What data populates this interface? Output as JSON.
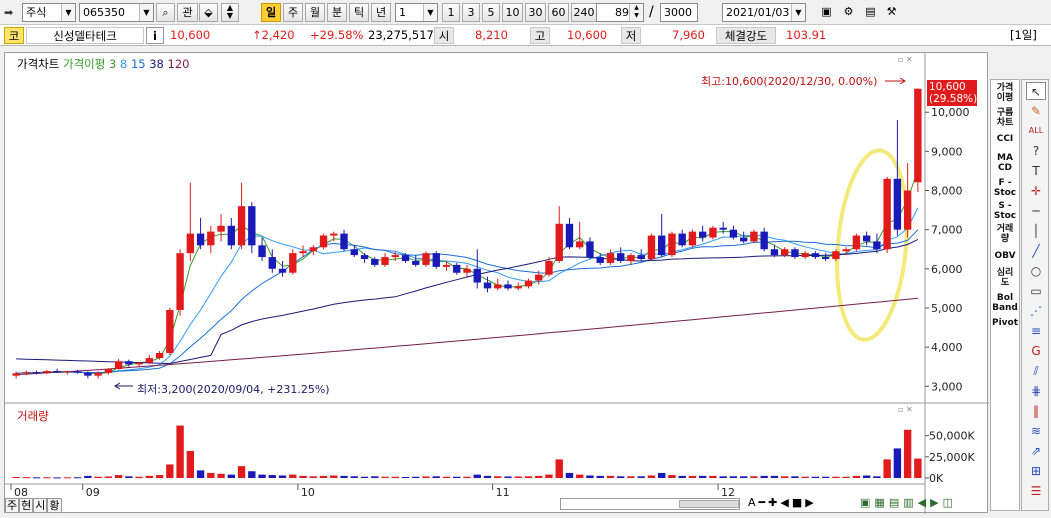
{
  "toolbar": {
    "market": "주식",
    "code": "065350",
    "gwan": "관",
    "periods": [
      "일",
      "주",
      "월",
      "분",
      "틱",
      "년"
    ],
    "active_period": "일",
    "interval": "1",
    "quick": [
      "1",
      "3",
      "5",
      "10",
      "30",
      "60",
      "240"
    ],
    "count": "89",
    "slash": "/",
    "total": "3000",
    "date": "2021/01/03",
    "period_label": "[1일]"
  },
  "quote": {
    "market_badge": "코",
    "name": "신성델타테크",
    "info": "i",
    "price": "10,600",
    "change": "↑2,420",
    "change_pct": "+29.58%",
    "volume": "23,275,517",
    "open_label": "시",
    "open": "8,210",
    "high_label": "고",
    "high": "10,600",
    "low_label": "저",
    "low": "7,960",
    "strength_label": "체결강도",
    "strength": "103.91"
  },
  "legend": {
    "price_chart": "가격차트",
    "ma_label": "가격이평",
    "ma_periods": [
      "3",
      "8",
      "15",
      "38",
      "120"
    ],
    "ma_colors": [
      "#3a9a2a",
      "#3399ff",
      "#1a6fd4",
      "#1a1a7a",
      "#7a1a4a"
    ],
    "volume_label": "거래량"
  },
  "annotations": {
    "high_note": "최고:10,600(2020/12/30, 0.00%)",
    "low_note": "최저:3,200(2020/09/04, +231.25%)",
    "current_price": "10,600",
    "current_pct": "(29.58%)"
  },
  "colors": {
    "up": "#e11b1b",
    "down": "#1a1ab8",
    "highlight": "#f2ea7a"
  },
  "chart_data": {
    "type": "candlestick",
    "y_ticks": [
      "10,000",
      "9,000",
      "8,000",
      "7,000",
      "6,000",
      "5,000",
      "4,000",
      "3,000"
    ],
    "y_tick_values": [
      10000,
      9000,
      8000,
      7000,
      6000,
      5000,
      4000,
      3000
    ],
    "ylim": [
      2700,
      10900
    ],
    "x_ticks": [
      {
        "label": "08",
        "index": 0
      },
      {
        "label": "09",
        "index": 7
      },
      {
        "label": "10",
        "index": 28
      },
      {
        "label": "11",
        "index": 47
      },
      {
        "label": "12",
        "index": 69
      }
    ],
    "candles": [
      [
        3270,
        3370,
        3200,
        3330
      ],
      [
        3330,
        3400,
        3280,
        3360
      ],
      [
        3360,
        3400,
        3300,
        3350
      ],
      [
        3350,
        3420,
        3310,
        3390
      ],
      [
        3390,
        3450,
        3340,
        3360
      ],
      [
        3360,
        3400,
        3300,
        3380
      ],
      [
        3380,
        3420,
        3320,
        3350
      ],
      [
        3350,
        3380,
        3200,
        3270
      ],
      [
        3270,
        3380,
        3200,
        3340
      ],
      [
        3340,
        3460,
        3300,
        3440
      ],
      [
        3440,
        3700,
        3420,
        3640
      ],
      [
        3640,
        3680,
        3500,
        3560
      ],
      [
        3560,
        3620,
        3480,
        3600
      ],
      [
        3600,
        3800,
        3560,
        3720
      ],
      [
        3720,
        3900,
        3680,
        3850
      ],
      [
        3850,
        5000,
        3800,
        4950
      ],
      [
        4950,
        6500,
        4800,
        6400
      ],
      [
        6400,
        8200,
        6200,
        6900
      ],
      [
        6900,
        7300,
        6500,
        6600
      ],
      [
        6600,
        7100,
        6400,
        6950
      ],
      [
        6950,
        7400,
        6700,
        7100
      ],
      [
        7100,
        7300,
        6500,
        6600
      ],
      [
        6600,
        8200,
        6500,
        7600
      ],
      [
        7600,
        7700,
        6400,
        6600
      ],
      [
        6600,
        6800,
        6200,
        6300
      ],
      [
        6300,
        6500,
        5900,
        6000
      ],
      [
        6000,
        6200,
        5800,
        5900
      ],
      [
        5900,
        6500,
        5850,
        6400
      ],
      [
        6400,
        6600,
        6300,
        6450
      ],
      [
        6450,
        6600,
        6350,
        6550
      ],
      [
        6550,
        6900,
        6500,
        6850
      ],
      [
        6850,
        6950,
        6700,
        6900
      ],
      [
        6900,
        7000,
        6450,
        6500
      ],
      [
        6500,
        6600,
        6300,
        6350
      ],
      [
        6350,
        6400,
        6150,
        6250
      ],
      [
        6250,
        6300,
        6050,
        6100
      ],
      [
        6100,
        6400,
        6050,
        6300
      ],
      [
        6300,
        6450,
        6200,
        6350
      ],
      [
        6350,
        6400,
        6150,
        6200
      ],
      [
        6200,
        6350,
        6050,
        6100
      ],
      [
        6100,
        6450,
        6050,
        6400
      ],
      [
        6400,
        6450,
        6000,
        6050
      ],
      [
        6050,
        6200,
        5950,
        6100
      ],
      [
        6100,
        6150,
        5850,
        5900
      ],
      [
        5900,
        6100,
        5800,
        6000
      ],
      [
        6000,
        6500,
        5500,
        5650
      ],
      [
        5650,
        5800,
        5400,
        5500
      ],
      [
        5500,
        5750,
        5450,
        5600
      ],
      [
        5600,
        5700,
        5450,
        5500
      ],
      [
        5500,
        5650,
        5450,
        5550
      ],
      [
        5550,
        5750,
        5500,
        5700
      ],
      [
        5700,
        5950,
        5600,
        5850
      ],
      [
        5850,
        6300,
        5800,
        6200
      ],
      [
        6200,
        7600,
        6150,
        7150
      ],
      [
        7150,
        7300,
        6500,
        6550
      ],
      [
        6550,
        7200,
        6500,
        6700
      ],
      [
        6700,
        6800,
        6250,
        6300
      ],
      [
        6300,
        6400,
        6100,
        6150
      ],
      [
        6150,
        6500,
        6100,
        6400
      ],
      [
        6400,
        6550,
        6150,
        6200
      ],
      [
        6200,
        6400,
        6100,
        6350
      ],
      [
        6350,
        6500,
        6200,
        6250
      ],
      [
        6250,
        6900,
        6200,
        6850
      ],
      [
        6850,
        7400,
        6300,
        6350
      ],
      [
        6350,
        6950,
        6300,
        6900
      ],
      [
        6900,
        7000,
        6550,
        6600
      ],
      [
        6600,
        7000,
        6550,
        6950
      ],
      [
        6950,
        7100,
        6700,
        6800
      ],
      [
        6800,
        7100,
        6750,
        7050
      ],
      [
        7050,
        7200,
        6900,
        7000
      ],
      [
        7000,
        7100,
        6750,
        6800
      ],
      [
        6800,
        6950,
        6650,
        6700
      ],
      [
        6700,
        7000,
        6650,
        6950
      ],
      [
        6950,
        7050,
        6450,
        6500
      ],
      [
        6500,
        6600,
        6300,
        6350
      ],
      [
        6350,
        6550,
        6300,
        6500
      ],
      [
        6500,
        6550,
        6250,
        6300
      ],
      [
        6300,
        6450,
        6250,
        6400
      ],
      [
        6400,
        6450,
        6250,
        6300
      ],
      [
        6300,
        6400,
        6200,
        6250
      ],
      [
        6250,
        6500,
        6200,
        6450
      ],
      [
        6450,
        6550,
        6350,
        6500
      ],
      [
        6500,
        6900,
        6450,
        6850
      ],
      [
        6850,
        6950,
        6600,
        6700
      ],
      [
        6700,
        6900,
        6400,
        6500
      ],
      [
        6500,
        8350,
        6400,
        8300
      ],
      [
        8300,
        9800,
        6850,
        7000
      ],
      [
        7000,
        8700,
        6800,
        8000
      ],
      [
        8210,
        10600,
        7960,
        10600
      ]
    ],
    "volume_ticks": [
      "50,000K",
      "25,000K",
      "0K"
    ],
    "volume_max": 65000,
    "volume": [
      1200,
      1000,
      800,
      900,
      700,
      800,
      900,
      2500,
      1500,
      1800,
      3500,
      2000,
      1500,
      2500,
      3500,
      16000,
      62000,
      32000,
      9000,
      6000,
      5000,
      4000,
      14000,
      8000,
      4000,
      3500,
      3000,
      4000,
      2500,
      2000,
      2500,
      3000,
      2500,
      2000,
      1500,
      2000,
      1500,
      1500,
      1200,
      1500,
      1800,
      2000,
      1500,
      1500,
      1500,
      4000,
      2500,
      2000,
      1800,
      1800,
      2000,
      2500,
      4000,
      22000,
      6000,
      4000,
      3000,
      2500,
      2500,
      2000,
      2000,
      2000,
      3000,
      6000,
      3500,
      2500,
      2500,
      2500,
      2500,
      2000,
      2000,
      2000,
      2000,
      2500,
      2500,
      2000,
      2000,
      1500,
      1500,
      1500,
      1500,
      1500,
      2500,
      3000,
      2000,
      22000,
      35000,
      57000,
      23000
    ],
    "ma5_3300": 3300,
    "ma120_end": 5250
  }
}
